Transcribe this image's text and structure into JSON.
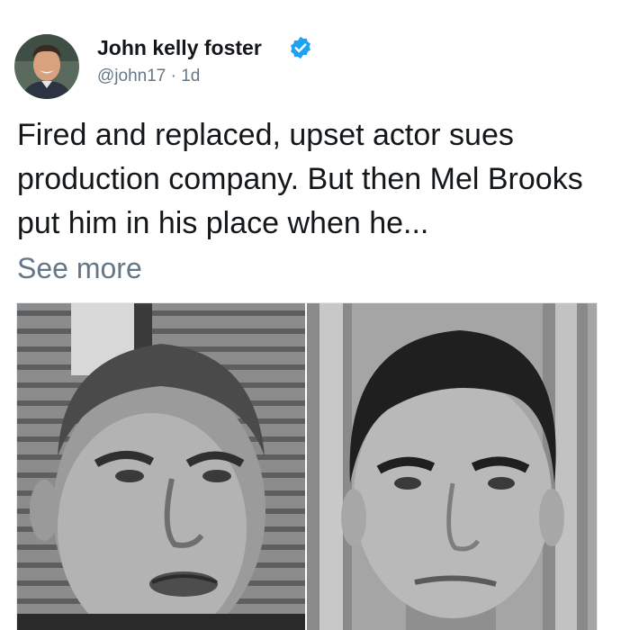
{
  "tweet": {
    "author": {
      "name": "John kelly foster",
      "handle": "@john17",
      "separator": " · ",
      "time": "1d",
      "verified": true,
      "avatar_icon": "user-avatar"
    },
    "text": "Fired and replaced, upset actor sues production company. But then Mel Brooks put him in his place when he...",
    "see_more": "See more",
    "photo": {
      "panels": [
        "left-portrait",
        "right-portrait"
      ],
      "style": "black-and-white"
    }
  },
  "colors": {
    "text": "#14171a",
    "secondary": "#657786",
    "verified": "#1da1f2"
  }
}
